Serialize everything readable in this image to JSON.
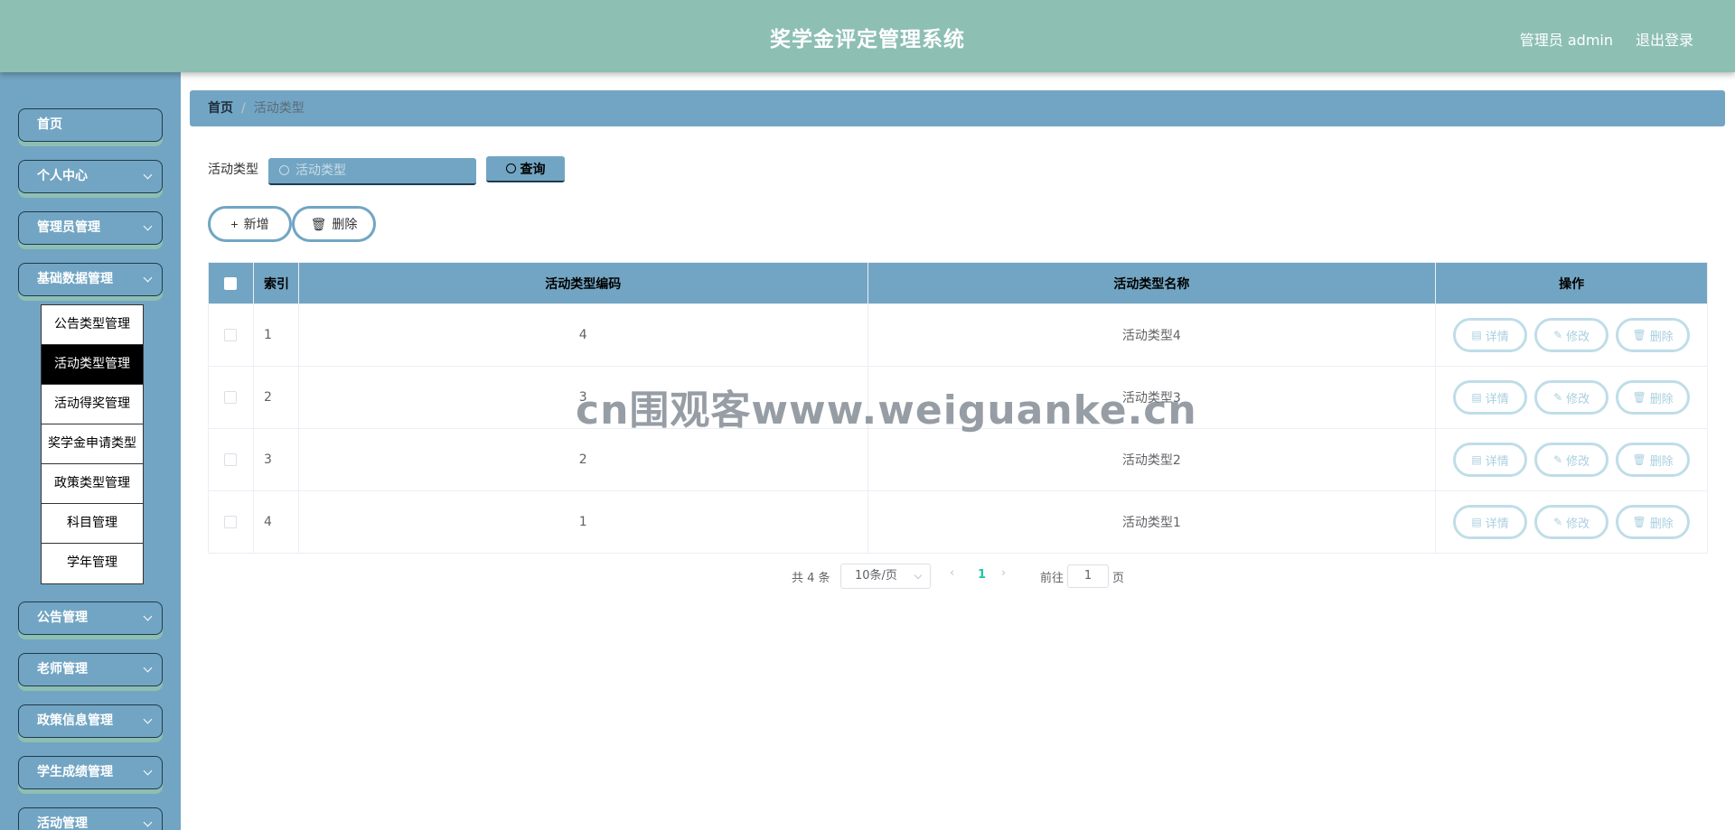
{
  "header": {
    "title": "奖学金评定管理系统",
    "user": "管理员 admin",
    "logout": "退出登录"
  },
  "sidebar": {
    "items": [
      {
        "label": "首页"
      },
      {
        "label": "个人中心"
      },
      {
        "label": "管理员管理"
      },
      {
        "label": "基础数据管理"
      },
      {
        "label": "公告管理"
      },
      {
        "label": "老师管理"
      },
      {
        "label": "政策信息管理"
      },
      {
        "label": "学生成绩管理"
      },
      {
        "label": "活动管理"
      }
    ],
    "submenu": [
      {
        "label": "公告类型管理"
      },
      {
        "label": "活动类型管理"
      },
      {
        "label": "活动得奖管理"
      },
      {
        "label": "奖学金申请类型"
      },
      {
        "label": "政策类型管理"
      },
      {
        "label": "科目管理"
      },
      {
        "label": "学年管理"
      }
    ]
  },
  "breadcrumb": {
    "home": "首页",
    "sep": "/",
    "current": "活动类型"
  },
  "search": {
    "label": "活动类型",
    "placeholder": "活动类型",
    "button": "查询"
  },
  "actions": {
    "add": "新增",
    "delete": "删除"
  },
  "table": {
    "headers": {
      "index": "索引",
      "code": "活动类型编码",
      "name": "活动类型名称",
      "op": "操作"
    },
    "rows": [
      {
        "index": "1",
        "code": "4",
        "name": "活动类型4"
      },
      {
        "index": "2",
        "code": "3",
        "name": "活动类型3"
      },
      {
        "index": "3",
        "code": "2",
        "name": "活动类型2"
      },
      {
        "index": "4",
        "code": "1",
        "name": "活动类型1"
      }
    ],
    "ops": {
      "detail": "详情",
      "edit": "修改",
      "delete": "删除"
    }
  },
  "pagination": {
    "total": "共 4 条",
    "size": "10条/页",
    "current": "1",
    "goto": "前往",
    "goto_value": "1",
    "page": "页"
  },
  "watermark": "cn围观客www.weiguanke.cn",
  "colors": {
    "header": "#8dbfb3",
    "sidebar": "#72a5c3",
    "accent": "#21c5a3"
  }
}
